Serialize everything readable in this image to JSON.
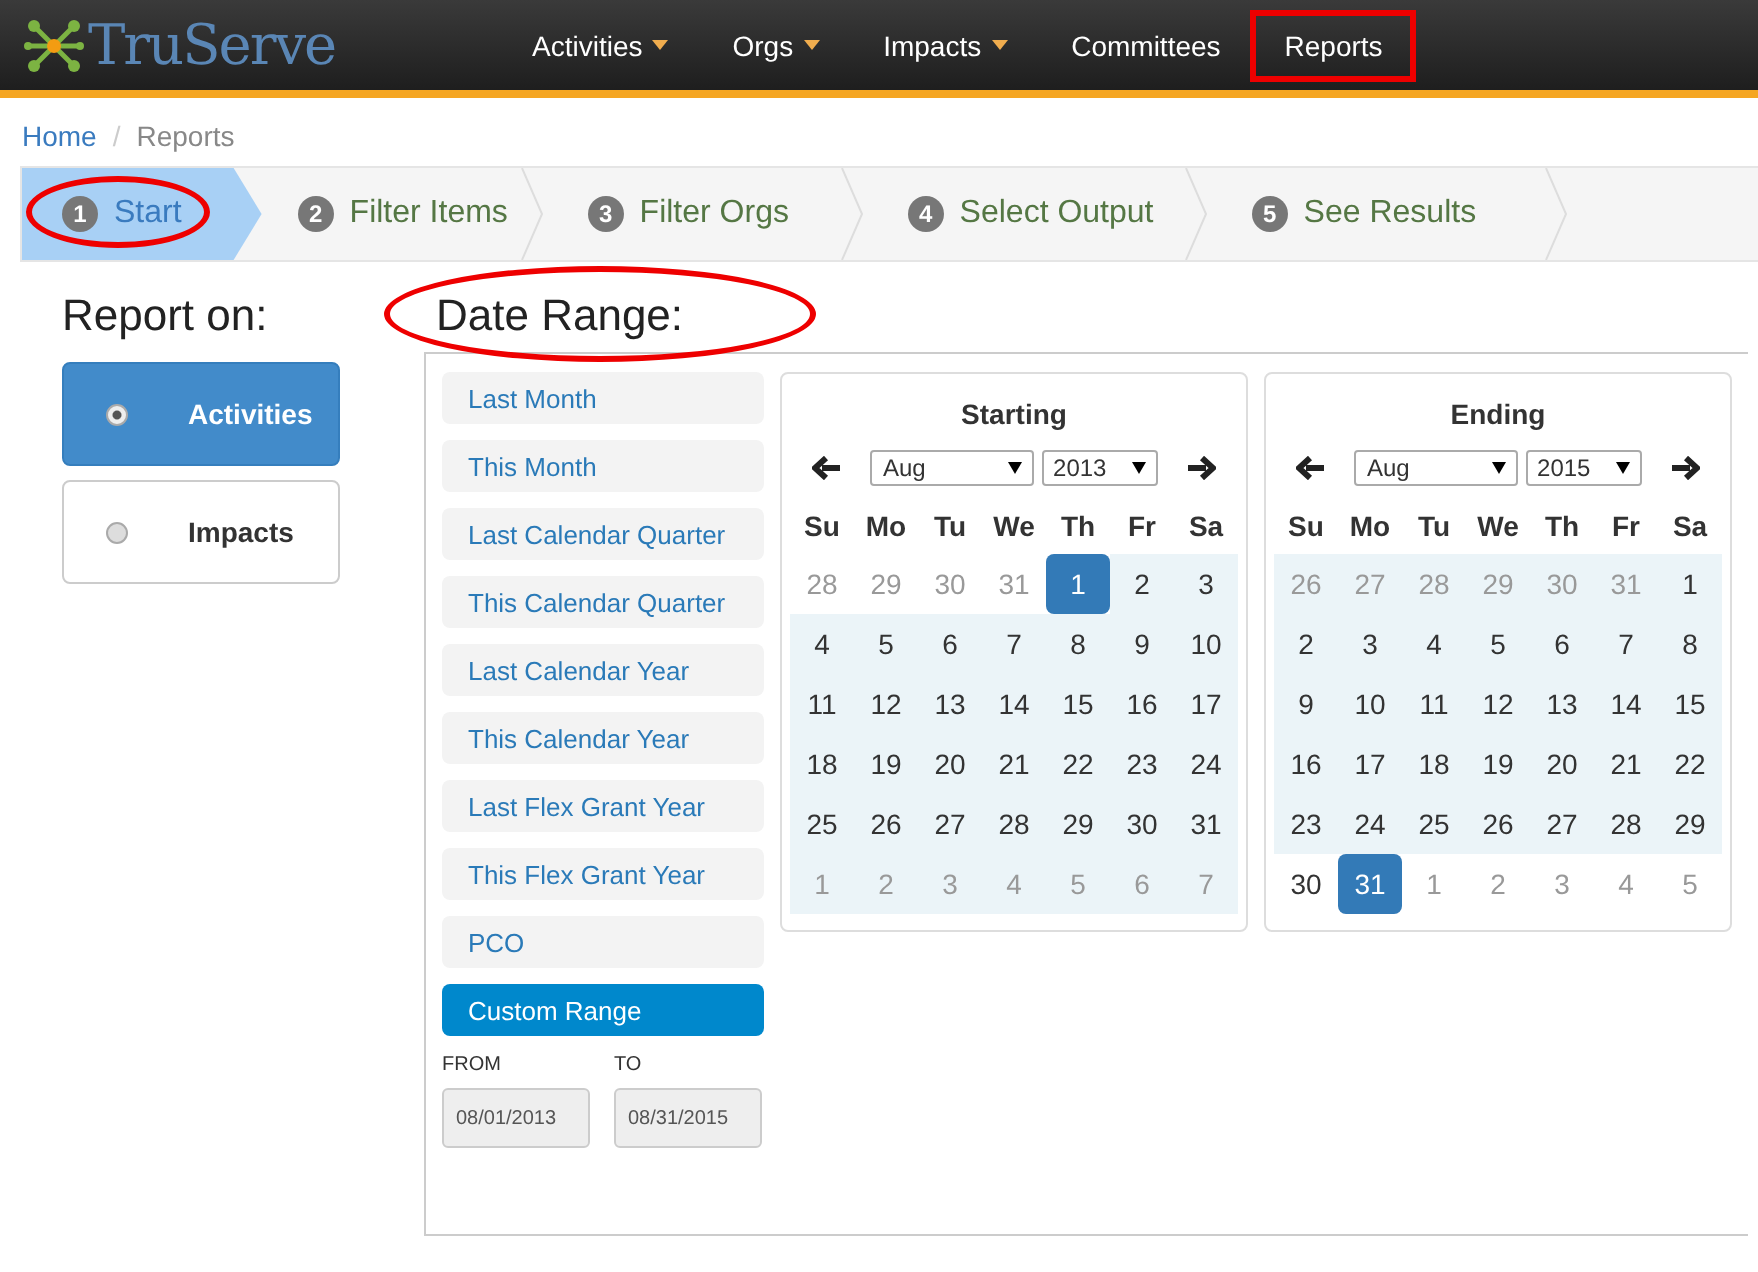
{
  "brand": {
    "name": "TruServe"
  },
  "nav": [
    {
      "label": "Activities",
      "has_dropdown": true,
      "annotated": false
    },
    {
      "label": "Orgs",
      "has_dropdown": true,
      "annotated": false
    },
    {
      "label": "Impacts",
      "has_dropdown": true,
      "annotated": false
    },
    {
      "label": "Committees",
      "has_dropdown": false,
      "annotated": false
    },
    {
      "label": "Reports",
      "has_dropdown": false,
      "annotated": true
    }
  ],
  "breadcrumb": [
    {
      "label": "Home",
      "link": true
    },
    {
      "separator": "/",
      "label": "Reports",
      "link": false
    }
  ],
  "steps": [
    {
      "number": "1",
      "label": "Start",
      "selected": true,
      "annotated": true
    },
    {
      "number": "2",
      "label": "Filter Items",
      "selected": false,
      "annotated": false
    },
    {
      "number": "3",
      "label": "Filter Orgs",
      "selected": false,
      "annotated": false
    },
    {
      "number": "4",
      "label": "Select Output",
      "selected": false,
      "annotated": false
    },
    {
      "number": "5",
      "label": "See Results",
      "selected": false,
      "annotated": false
    }
  ],
  "report_on": {
    "heading": "Report on:",
    "options": [
      {
        "label": "Activities",
        "selected": true
      },
      {
        "label": "Impacts",
        "selected": false
      }
    ]
  },
  "date_range": {
    "heading": "Date Range:",
    "heading_annotated": true,
    "presets": [
      {
        "label": "Last Month",
        "selected": false
      },
      {
        "label": "This Month",
        "selected": false
      },
      {
        "label": "Last Calendar Quarter",
        "selected": false
      },
      {
        "label": "This Calendar Quarter",
        "selected": false
      },
      {
        "label": "Last Calendar Year",
        "selected": false
      },
      {
        "label": "This Calendar Year",
        "selected": false
      },
      {
        "label": "Last Flex Grant Year",
        "selected": false
      },
      {
        "label": "This Flex Grant Year",
        "selected": false
      },
      {
        "label": "PCO",
        "selected": false
      },
      {
        "label": "Custom Range",
        "selected": true
      }
    ],
    "from": {
      "label": "FROM",
      "value": "08/01/2013"
    },
    "to": {
      "label": "TO",
      "value": "08/31/2015"
    },
    "calendars": [
      {
        "title": "Starting",
        "month": "Aug",
        "year": "2013",
        "weekdays": [
          "Su",
          "Mo",
          "Tu",
          "We",
          "Th",
          "Fr",
          "Sa"
        ],
        "weeks": [
          [
            {
              "day": "28",
              "other_month": true,
              "in_range": false,
              "selected": false
            },
            {
              "day": "29",
              "other_month": true,
              "in_range": false,
              "selected": false
            },
            {
              "day": "30",
              "other_month": true,
              "in_range": false,
              "selected": false
            },
            {
              "day": "31",
              "other_month": true,
              "in_range": false,
              "selected": false
            },
            {
              "day": "1",
              "other_month": false,
              "in_range": true,
              "selected": true
            },
            {
              "day": "2",
              "other_month": false,
              "in_range": true,
              "selected": false
            },
            {
              "day": "3",
              "other_month": false,
              "in_range": true,
              "selected": false
            }
          ],
          [
            {
              "day": "4",
              "other_month": false,
              "in_range": true,
              "selected": false
            },
            {
              "day": "5",
              "other_month": false,
              "in_range": true,
              "selected": false
            },
            {
              "day": "6",
              "other_month": false,
              "in_range": true,
              "selected": false
            },
            {
              "day": "7",
              "other_month": false,
              "in_range": true,
              "selected": false
            },
            {
              "day": "8",
              "other_month": false,
              "in_range": true,
              "selected": false
            },
            {
              "day": "9",
              "other_month": false,
              "in_range": true,
              "selected": false
            },
            {
              "day": "10",
              "other_month": false,
              "in_range": true,
              "selected": false
            }
          ],
          [
            {
              "day": "11",
              "other_month": false,
              "in_range": true,
              "selected": false
            },
            {
              "day": "12",
              "other_month": false,
              "in_range": true,
              "selected": false
            },
            {
              "day": "13",
              "other_month": false,
              "in_range": true,
              "selected": false
            },
            {
              "day": "14",
              "other_month": false,
              "in_range": true,
              "selected": false
            },
            {
              "day": "15",
              "other_month": false,
              "in_range": true,
              "selected": false
            },
            {
              "day": "16",
              "other_month": false,
              "in_range": true,
              "selected": false
            },
            {
              "day": "17",
              "other_month": false,
              "in_range": true,
              "selected": false
            }
          ],
          [
            {
              "day": "18",
              "other_month": false,
              "in_range": true,
              "selected": false
            },
            {
              "day": "19",
              "other_month": false,
              "in_range": true,
              "selected": false
            },
            {
              "day": "20",
              "other_month": false,
              "in_range": true,
              "selected": false
            },
            {
              "day": "21",
              "other_month": false,
              "in_range": true,
              "selected": false
            },
            {
              "day": "22",
              "other_month": false,
              "in_range": true,
              "selected": false
            },
            {
              "day": "23",
              "other_month": false,
              "in_range": true,
              "selected": false
            },
            {
              "day": "24",
              "other_month": false,
              "in_range": true,
              "selected": false
            }
          ],
          [
            {
              "day": "25",
              "other_month": false,
              "in_range": true,
              "selected": false
            },
            {
              "day": "26",
              "other_month": false,
              "in_range": true,
              "selected": false
            },
            {
              "day": "27",
              "other_month": false,
              "in_range": true,
              "selected": false
            },
            {
              "day": "28",
              "other_month": false,
              "in_range": true,
              "selected": false
            },
            {
              "day": "29",
              "other_month": false,
              "in_range": true,
              "selected": false
            },
            {
              "day": "30",
              "other_month": false,
              "in_range": true,
              "selected": false
            },
            {
              "day": "31",
              "other_month": false,
              "in_range": true,
              "selected": false
            }
          ],
          [
            {
              "day": "1",
              "other_month": true,
              "in_range": true,
              "selected": false
            },
            {
              "day": "2",
              "other_month": true,
              "in_range": true,
              "selected": false
            },
            {
              "day": "3",
              "other_month": true,
              "in_range": true,
              "selected": false
            },
            {
              "day": "4",
              "other_month": true,
              "in_range": true,
              "selected": false
            },
            {
              "day": "5",
              "other_month": true,
              "in_range": true,
              "selected": false
            },
            {
              "day": "6",
              "other_month": true,
              "in_range": true,
              "selected": false
            },
            {
              "day": "7",
              "other_month": true,
              "in_range": true,
              "selected": false
            }
          ]
        ]
      },
      {
        "title": "Ending",
        "month": "Aug",
        "year": "2015",
        "weekdays": [
          "Su",
          "Mo",
          "Tu",
          "We",
          "Th",
          "Fr",
          "Sa"
        ],
        "weeks": [
          [
            {
              "day": "26",
              "other_month": true,
              "in_range": true,
              "selected": false
            },
            {
              "day": "27",
              "other_month": true,
              "in_range": true,
              "selected": false
            },
            {
              "day": "28",
              "other_month": true,
              "in_range": true,
              "selected": false
            },
            {
              "day": "29",
              "other_month": true,
              "in_range": true,
              "selected": false
            },
            {
              "day": "30",
              "other_month": true,
              "in_range": true,
              "selected": false
            },
            {
              "day": "31",
              "other_month": true,
              "in_range": true,
              "selected": false
            },
            {
              "day": "1",
              "other_month": false,
              "in_range": true,
              "selected": false
            }
          ],
          [
            {
              "day": "2",
              "other_month": false,
              "in_range": true,
              "selected": false
            },
            {
              "day": "3",
              "other_month": false,
              "in_range": true,
              "selected": false
            },
            {
              "day": "4",
              "other_month": false,
              "in_range": true,
              "selected": false
            },
            {
              "day": "5",
              "other_month": false,
              "in_range": true,
              "selected": false
            },
            {
              "day": "6",
              "other_month": false,
              "in_range": true,
              "selected": false
            },
            {
              "day": "7",
              "other_month": false,
              "in_range": true,
              "selected": false
            },
            {
              "day": "8",
              "other_month": false,
              "in_range": true,
              "selected": false
            }
          ],
          [
            {
              "day": "9",
              "other_month": false,
              "in_range": true,
              "selected": false
            },
            {
              "day": "10",
              "other_month": false,
              "in_range": true,
              "selected": false
            },
            {
              "day": "11",
              "other_month": false,
              "in_range": true,
              "selected": false
            },
            {
              "day": "12",
              "other_month": false,
              "in_range": true,
              "selected": false
            },
            {
              "day": "13",
              "other_month": false,
              "in_range": true,
              "selected": false
            },
            {
              "day": "14",
              "other_month": false,
              "in_range": true,
              "selected": false
            },
            {
              "day": "15",
              "other_month": false,
              "in_range": true,
              "selected": false
            }
          ],
          [
            {
              "day": "16",
              "other_month": false,
              "in_range": true,
              "selected": false
            },
            {
              "day": "17",
              "other_month": false,
              "in_range": true,
              "selected": false
            },
            {
              "day": "18",
              "other_month": false,
              "in_range": true,
              "selected": false
            },
            {
              "day": "19",
              "other_month": false,
              "in_range": true,
              "selected": false
            },
            {
              "day": "20",
              "other_month": false,
              "in_range": true,
              "selected": false
            },
            {
              "day": "21",
              "other_month": false,
              "in_range": true,
              "selected": false
            },
            {
              "day": "22",
              "other_month": false,
              "in_range": true,
              "selected": false
            }
          ],
          [
            {
              "day": "23",
              "other_month": false,
              "in_range": true,
              "selected": false
            },
            {
              "day": "24",
              "other_month": false,
              "in_range": true,
              "selected": false
            },
            {
              "day": "25",
              "other_month": false,
              "in_range": true,
              "selected": false
            },
            {
              "day": "26",
              "other_month": false,
              "in_range": true,
              "selected": false
            },
            {
              "day": "27",
              "other_month": false,
              "in_range": true,
              "selected": false
            },
            {
              "day": "28",
              "other_month": false,
              "in_range": true,
              "selected": false
            },
            {
              "day": "29",
              "other_month": false,
              "in_range": true,
              "selected": false
            }
          ],
          [
            {
              "day": "30",
              "other_month": false,
              "in_range": false,
              "selected": false
            },
            {
              "day": "31",
              "other_month": false,
              "in_range": true,
              "selected": true
            },
            {
              "day": "1",
              "other_month": true,
              "in_range": false,
              "selected": false
            },
            {
              "day": "2",
              "other_month": true,
              "in_range": false,
              "selected": false
            },
            {
              "day": "3",
              "other_month": true,
              "in_range": false,
              "selected": false
            },
            {
              "day": "4",
              "other_month": true,
              "in_range": false,
              "selected": false
            },
            {
              "day": "5",
              "other_month": true,
              "in_range": false,
              "selected": false
            }
          ]
        ]
      }
    ]
  }
}
